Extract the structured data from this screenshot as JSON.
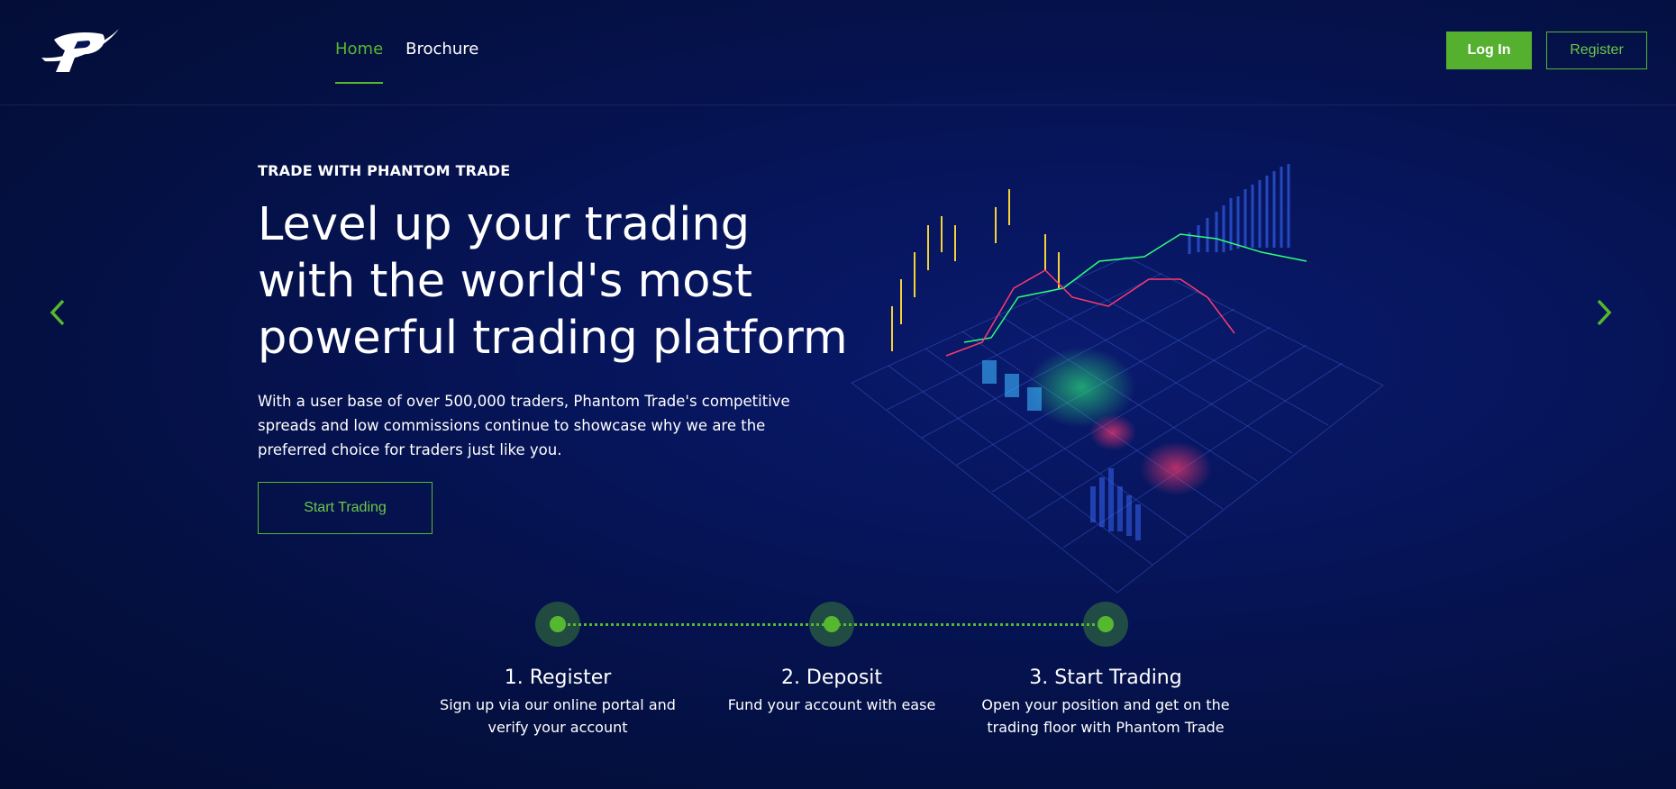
{
  "header": {
    "logo": "phantom-trade-logo",
    "nav": [
      {
        "label": "Home",
        "active": true
      },
      {
        "label": "Brochure",
        "active": false
      }
    ],
    "login_label": "Log In",
    "register_label": "Register"
  },
  "hero": {
    "eyebrow": "TRADE WITH PHANTOM TRADE",
    "headline": "Level up your trading with the world's most powerful trading platform",
    "description": "With a user base of over 500,000 traders, Phantom Trade's competitive spreads and low commissions continue to showcase why we are the preferred choice for traders just like you.",
    "cta_label": "Start Trading"
  },
  "carousel": {
    "prev_icon": "chevron-left-icon",
    "next_icon": "chevron-right-icon"
  },
  "steps": [
    {
      "title": "1. Register",
      "desc_line1": "Sign up via our online portal and",
      "desc_line2": "verify your account"
    },
    {
      "title": "2. Deposit",
      "desc_line1": "Fund your account with ease",
      "desc_line2": ""
    },
    {
      "title": "3. Start Trading",
      "desc_line1": "Open your position and get on the",
      "desc_line2": "trading floor with Phantom Trade"
    }
  ],
  "colors": {
    "accent": "#56b82f",
    "background": "#061459",
    "text": "#ffffff"
  }
}
